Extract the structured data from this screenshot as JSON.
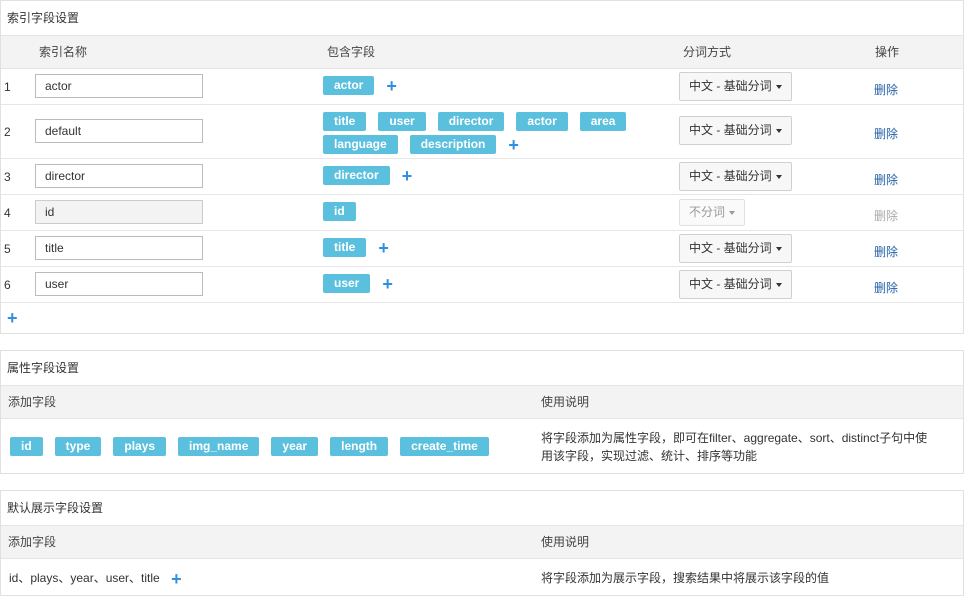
{
  "index_panel": {
    "title": "索引字段设置",
    "headers": {
      "name": "索引名称",
      "fields": "包含字段",
      "segment": "分词方式",
      "action": "操作"
    },
    "rows": [
      {
        "index": "1",
        "name": "actor",
        "fields": [
          "actor"
        ],
        "segment": "中文 - 基础分词",
        "action": "删除"
      },
      {
        "index": "2",
        "name": "default",
        "fields": [
          "title",
          "user",
          "director",
          "actor",
          "area",
          "language",
          "description"
        ],
        "segment": "中文 - 基础分词",
        "action": "删除"
      },
      {
        "index": "3",
        "name": "director",
        "fields": [
          "director"
        ],
        "segment": "中文 - 基础分词",
        "action": "删除"
      },
      {
        "index": "4",
        "name": "id",
        "fields": [
          "id"
        ],
        "segment": "不分词",
        "action": "删除"
      },
      {
        "index": "5",
        "name": "title",
        "fields": [
          "title"
        ],
        "segment": "中文 - 基础分词",
        "action": "删除"
      },
      {
        "index": "6",
        "name": "user",
        "fields": [
          "user"
        ],
        "segment": "中文 - 基础分词",
        "action": "删除"
      }
    ],
    "add_icon": "plus-icon"
  },
  "attr_panel": {
    "title": "属性字段设置",
    "headers": {
      "add": "添加字段",
      "desc": "使用说明"
    },
    "fields": [
      "id",
      "type",
      "plays",
      "img_name",
      "year",
      "length",
      "create_time"
    ],
    "desc_line1": "将字段添加为属性字段，即可在filter、aggregate、sort、distinct子句中使",
    "desc_line2": "用该字段，实现过滤、统计、排序等功能"
  },
  "display_panel": {
    "title": "默认展示字段设置",
    "headers": {
      "add": "添加字段",
      "desc": "使用说明"
    },
    "fields_text": "id、plays、year、user、title",
    "desc": "将字段添加为展示字段，搜索结果中将展示该字段的值"
  },
  "colors": {
    "tag": "#5bc0de",
    "plus": "#2f8fe0",
    "link": "#2561a8"
  }
}
